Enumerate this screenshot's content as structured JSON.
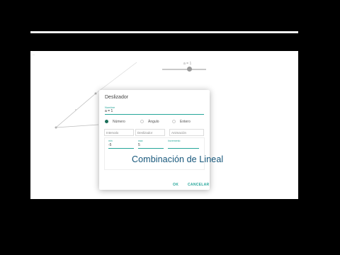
{
  "canvas": {
    "corner_mark": "—",
    "slider_caption": "a = 1"
  },
  "dialog": {
    "title": "Deslizador",
    "name_label": "Nombre",
    "name_value": "a = 1",
    "types": [
      {
        "label": "Número",
        "selected": true
      },
      {
        "label": "Ángulo",
        "selected": false
      },
      {
        "label": "Entero",
        "selected": false
      }
    ],
    "mode_placeholders": [
      "Intervalo",
      "Deslizador",
      "Animación"
    ],
    "fields": [
      {
        "label": "min",
        "value": "-5"
      },
      {
        "label": "max",
        "value": "5"
      },
      {
        "label": "Incremento",
        "value": ""
      }
    ],
    "ok_label": "OK",
    "cancel_label": "CANCELAR"
  },
  "overlay": {
    "text": "Combinación de Lineal"
  },
  "colors": {
    "accent": "#26a69a",
    "radio_on": "#1b6f5a",
    "overlay_text": "#15567a"
  }
}
